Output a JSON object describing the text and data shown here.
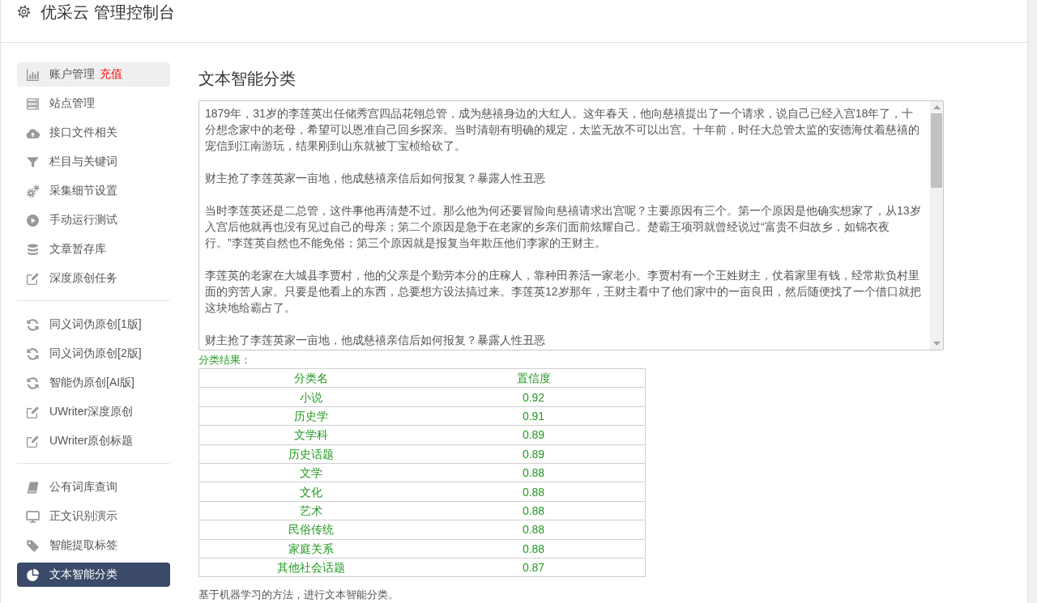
{
  "header": {
    "title": "优采云 管理控制台"
  },
  "sidebar": {
    "sections": [
      {
        "items": [
          {
            "label": "账户管理",
            "link": "充值",
            "hovered": true,
            "selected": false
          },
          {
            "label": "站点管理",
            "hovered": false,
            "selected": false
          },
          {
            "label": "接口文件相关",
            "hovered": false,
            "selected": false
          },
          {
            "label": "栏目与关键词",
            "hovered": false,
            "selected": false
          },
          {
            "label": "采集细节设置",
            "hovered": false,
            "selected": false
          },
          {
            "label": "手动运行测试",
            "hovered": false,
            "selected": false
          },
          {
            "label": "文章暂存库",
            "hovered": false,
            "selected": false
          },
          {
            "label": "深度原创任务",
            "hovered": false,
            "selected": false
          }
        ]
      },
      {
        "items": [
          {
            "label": "同义词伪原创[1版]",
            "hovered": false,
            "selected": false
          },
          {
            "label": "同义词伪原创[2版]",
            "hovered": false,
            "selected": false
          },
          {
            "label": "智能伪原创[AI版]",
            "hovered": false,
            "selected": false
          },
          {
            "label": "UWriter深度原创",
            "hovered": false,
            "selected": false
          },
          {
            "label": "UWriter原创标题",
            "hovered": false,
            "selected": false
          }
        ]
      },
      {
        "items": [
          {
            "label": "公有词库查询",
            "hovered": false,
            "selected": false
          },
          {
            "label": "正文识别演示",
            "hovered": false,
            "selected": false
          },
          {
            "label": "智能提取标签",
            "hovered": false,
            "selected": false
          },
          {
            "label": "文本智能分类",
            "hovered": false,
            "selected": true
          }
        ]
      }
    ]
  },
  "main": {
    "title": "文本智能分类",
    "text_area": {
      "paragraphs": [
        "1879年，31岁的李莲英出任储秀宫四品花翎总管，成为慈禧身边的大红人。这年春天，他向慈禧提出了一个请求，说自己已经入宫18年了，十分想念家中的老母，希望可以恩准自己回乡探亲。当时清朝有明确的规定，太监无故不可以出宫。十年前，时任大总管太监的安德海仗着慈禧的宠信到江南游玩，结果刚到山东就被丁宝桢给砍了。",
        "财主抢了李莲英家一亩地，他成慈禧亲信后如何报复？暴露人性丑恶",
        "当时李莲英还是二总管，这件事他再清楚不过。那么他为何还要冒险向慈禧请求出宫呢？主要原因有三个。第一个原因是他确实想家了，从13岁入宫后他就再也没有见过自己的母亲；第二个原因是急于在老家的乡亲们面前炫耀自己。楚霸王项羽就曾经说过“富贵不归故乡，如锦衣夜行。”李莲英自然也不能免俗；第三个原因就是报复当年欺压他们李家的王财主。",
        "李莲英的老家在大城县李贾村，他的父亲是个勤劳本分的庄稼人，靠种田养活一家老小。李贾村有一个王姓财主，仗着家里有钱，经常欺负村里面的穷苦人家。只要是他看上的东西，总要想方设法搞过来。李莲英12岁那年，王财主看中了他们家中的一亩良田，然后随便找了一个借口就把这块地给霸占了。",
        "财主抢了李莲英家一亩地，他成慈禧亲信后如何报复？暴露人性丑恶"
      ]
    },
    "result_label": "分类结果：",
    "table": {
      "columns": [
        "分类名",
        "置信度"
      ],
      "rows": [
        [
          "小说",
          "0.92"
        ],
        [
          "历史学",
          "0.91"
        ],
        [
          "文学科",
          "0.89"
        ],
        [
          "历史话题",
          "0.89"
        ],
        [
          "文学",
          "0.88"
        ],
        [
          "文化",
          "0.88"
        ],
        [
          "艺术",
          "0.88"
        ],
        [
          "民俗传统",
          "0.88"
        ],
        [
          "家庭关系",
          "0.88"
        ],
        [
          "其他社会话题",
          "0.87"
        ]
      ]
    },
    "note": "基于机器学习的方法，进行文本智能分类。"
  }
}
